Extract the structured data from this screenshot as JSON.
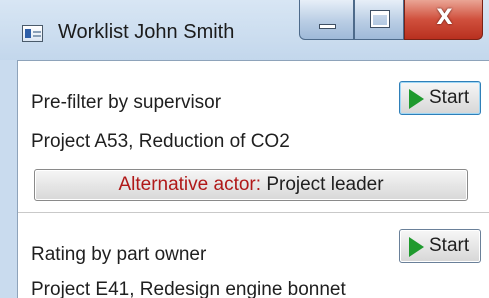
{
  "window": {
    "title": "Worklist John Smith",
    "close_glyph": "X"
  },
  "tasks": [
    {
      "name": "Pre-filter by supervisor",
      "project": "Project A53, Reduction of CO2",
      "start_label": "Start",
      "alternative_actor_label": "Alternative actor:",
      "alternative_actor_value": "Project leader"
    },
    {
      "name": "Rating by part owner",
      "project": "Project E41, Redesign engine bonnet",
      "start_label": "Start"
    }
  ],
  "colors": {
    "alt_key": "#b01818",
    "play": "#1f9a2e",
    "close_button": "#d0503d"
  },
  "icons": {
    "app": "worklist-app-icon",
    "start": "play-icon"
  }
}
